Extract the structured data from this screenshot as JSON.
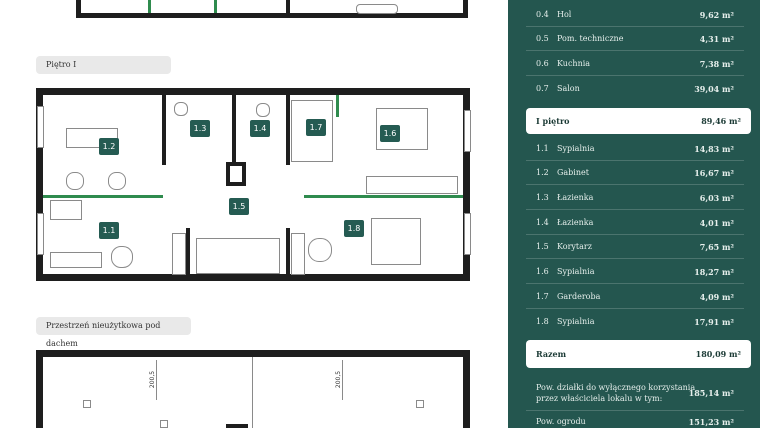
{
  "sections": {
    "floor1_label": "Piętro I",
    "attic_label": "Przestrzeń nieużytkowa pod dachem"
  },
  "plan_labels": [
    "1.2",
    "1.3",
    "1.4",
    "1.7",
    "1.6",
    "1.5",
    "1.1",
    "1.8"
  ],
  "attic_dims": [
    "200,5",
    "200,5"
  ],
  "table": {
    "top_rows": [
      {
        "num": "0.4",
        "name": "Hol",
        "area": "9,62 m²"
      },
      {
        "num": "0.5",
        "name": "Pom. techniczne",
        "area": "4,31 m²"
      },
      {
        "num": "0.6",
        "name": "Kuchnia",
        "area": "7,38 m²"
      },
      {
        "num": "0.7",
        "name": "Salon",
        "area": "39,04 m²"
      }
    ],
    "floor_header": {
      "name": "I piętro",
      "area": "89,46 m²"
    },
    "floor_rows": [
      {
        "num": "1.1",
        "name": "Sypialnia",
        "area": "14,83 m²"
      },
      {
        "num": "1.2",
        "name": "Gabinet",
        "area": "16,67 m²"
      },
      {
        "num": "1.3",
        "name": "Łazienka",
        "area": "6,03 m²"
      },
      {
        "num": "1.4",
        "name": "Łazienka",
        "area": "4,01 m²"
      },
      {
        "num": "1.5",
        "name": "Korytarz",
        "area": "7,65 m²"
      },
      {
        "num": "1.6",
        "name": "Sypialnia",
        "area": "18,27 m²"
      },
      {
        "num": "1.7",
        "name": "Garderoba",
        "area": "4,09 m²"
      },
      {
        "num": "1.8",
        "name": "Sypialnia",
        "area": "17,91 m²"
      }
    ],
    "total": {
      "name": "Razem",
      "area": "180,09 m²"
    },
    "plot_line1": "Pow. działki do wyłącznego korzystania",
    "plot_line2": "przez właściciela lokalu w tym:",
    "plot_area": "185,14 m²",
    "garden_name": "Pow. ogrodu",
    "garden_area": "151,23 m²"
  },
  "colors": {
    "panel": "#24564f",
    "room_tag": "#255b52",
    "wall": "#1e1e1e",
    "accent_green": "#2f8b4e"
  }
}
